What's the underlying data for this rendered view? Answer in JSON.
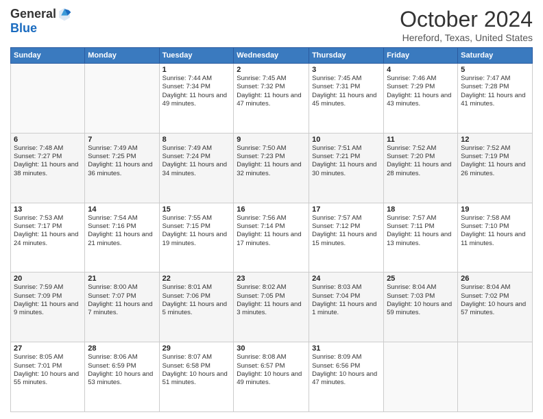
{
  "header": {
    "logo_line1": "General",
    "logo_line2": "Blue",
    "month_title": "October 2024",
    "location": "Hereford, Texas, United States"
  },
  "days_of_week": [
    "Sunday",
    "Monday",
    "Tuesday",
    "Wednesday",
    "Thursday",
    "Friday",
    "Saturday"
  ],
  "weeks": [
    [
      {
        "day": "",
        "info": ""
      },
      {
        "day": "",
        "info": ""
      },
      {
        "day": "1",
        "info": "Sunrise: 7:44 AM\nSunset: 7:34 PM\nDaylight: 11 hours and 49 minutes."
      },
      {
        "day": "2",
        "info": "Sunrise: 7:45 AM\nSunset: 7:32 PM\nDaylight: 11 hours and 47 minutes."
      },
      {
        "day": "3",
        "info": "Sunrise: 7:45 AM\nSunset: 7:31 PM\nDaylight: 11 hours and 45 minutes."
      },
      {
        "day": "4",
        "info": "Sunrise: 7:46 AM\nSunset: 7:29 PM\nDaylight: 11 hours and 43 minutes."
      },
      {
        "day": "5",
        "info": "Sunrise: 7:47 AM\nSunset: 7:28 PM\nDaylight: 11 hours and 41 minutes."
      }
    ],
    [
      {
        "day": "6",
        "info": "Sunrise: 7:48 AM\nSunset: 7:27 PM\nDaylight: 11 hours and 38 minutes."
      },
      {
        "day": "7",
        "info": "Sunrise: 7:49 AM\nSunset: 7:25 PM\nDaylight: 11 hours and 36 minutes."
      },
      {
        "day": "8",
        "info": "Sunrise: 7:49 AM\nSunset: 7:24 PM\nDaylight: 11 hours and 34 minutes."
      },
      {
        "day": "9",
        "info": "Sunrise: 7:50 AM\nSunset: 7:23 PM\nDaylight: 11 hours and 32 minutes."
      },
      {
        "day": "10",
        "info": "Sunrise: 7:51 AM\nSunset: 7:21 PM\nDaylight: 11 hours and 30 minutes."
      },
      {
        "day": "11",
        "info": "Sunrise: 7:52 AM\nSunset: 7:20 PM\nDaylight: 11 hours and 28 minutes."
      },
      {
        "day": "12",
        "info": "Sunrise: 7:52 AM\nSunset: 7:19 PM\nDaylight: 11 hours and 26 minutes."
      }
    ],
    [
      {
        "day": "13",
        "info": "Sunrise: 7:53 AM\nSunset: 7:17 PM\nDaylight: 11 hours and 24 minutes."
      },
      {
        "day": "14",
        "info": "Sunrise: 7:54 AM\nSunset: 7:16 PM\nDaylight: 11 hours and 21 minutes."
      },
      {
        "day": "15",
        "info": "Sunrise: 7:55 AM\nSunset: 7:15 PM\nDaylight: 11 hours and 19 minutes."
      },
      {
        "day": "16",
        "info": "Sunrise: 7:56 AM\nSunset: 7:14 PM\nDaylight: 11 hours and 17 minutes."
      },
      {
        "day": "17",
        "info": "Sunrise: 7:57 AM\nSunset: 7:12 PM\nDaylight: 11 hours and 15 minutes."
      },
      {
        "day": "18",
        "info": "Sunrise: 7:57 AM\nSunset: 7:11 PM\nDaylight: 11 hours and 13 minutes."
      },
      {
        "day": "19",
        "info": "Sunrise: 7:58 AM\nSunset: 7:10 PM\nDaylight: 11 hours and 11 minutes."
      }
    ],
    [
      {
        "day": "20",
        "info": "Sunrise: 7:59 AM\nSunset: 7:09 PM\nDaylight: 11 hours and 9 minutes."
      },
      {
        "day": "21",
        "info": "Sunrise: 8:00 AM\nSunset: 7:07 PM\nDaylight: 11 hours and 7 minutes."
      },
      {
        "day": "22",
        "info": "Sunrise: 8:01 AM\nSunset: 7:06 PM\nDaylight: 11 hours and 5 minutes."
      },
      {
        "day": "23",
        "info": "Sunrise: 8:02 AM\nSunset: 7:05 PM\nDaylight: 11 hours and 3 minutes."
      },
      {
        "day": "24",
        "info": "Sunrise: 8:03 AM\nSunset: 7:04 PM\nDaylight: 11 hours and 1 minute."
      },
      {
        "day": "25",
        "info": "Sunrise: 8:04 AM\nSunset: 7:03 PM\nDaylight: 10 hours and 59 minutes."
      },
      {
        "day": "26",
        "info": "Sunrise: 8:04 AM\nSunset: 7:02 PM\nDaylight: 10 hours and 57 minutes."
      }
    ],
    [
      {
        "day": "27",
        "info": "Sunrise: 8:05 AM\nSunset: 7:01 PM\nDaylight: 10 hours and 55 minutes."
      },
      {
        "day": "28",
        "info": "Sunrise: 8:06 AM\nSunset: 6:59 PM\nDaylight: 10 hours and 53 minutes."
      },
      {
        "day": "29",
        "info": "Sunrise: 8:07 AM\nSunset: 6:58 PM\nDaylight: 10 hours and 51 minutes."
      },
      {
        "day": "30",
        "info": "Sunrise: 8:08 AM\nSunset: 6:57 PM\nDaylight: 10 hours and 49 minutes."
      },
      {
        "day": "31",
        "info": "Sunrise: 8:09 AM\nSunset: 6:56 PM\nDaylight: 10 hours and 47 minutes."
      },
      {
        "day": "",
        "info": ""
      },
      {
        "day": "",
        "info": ""
      }
    ]
  ]
}
